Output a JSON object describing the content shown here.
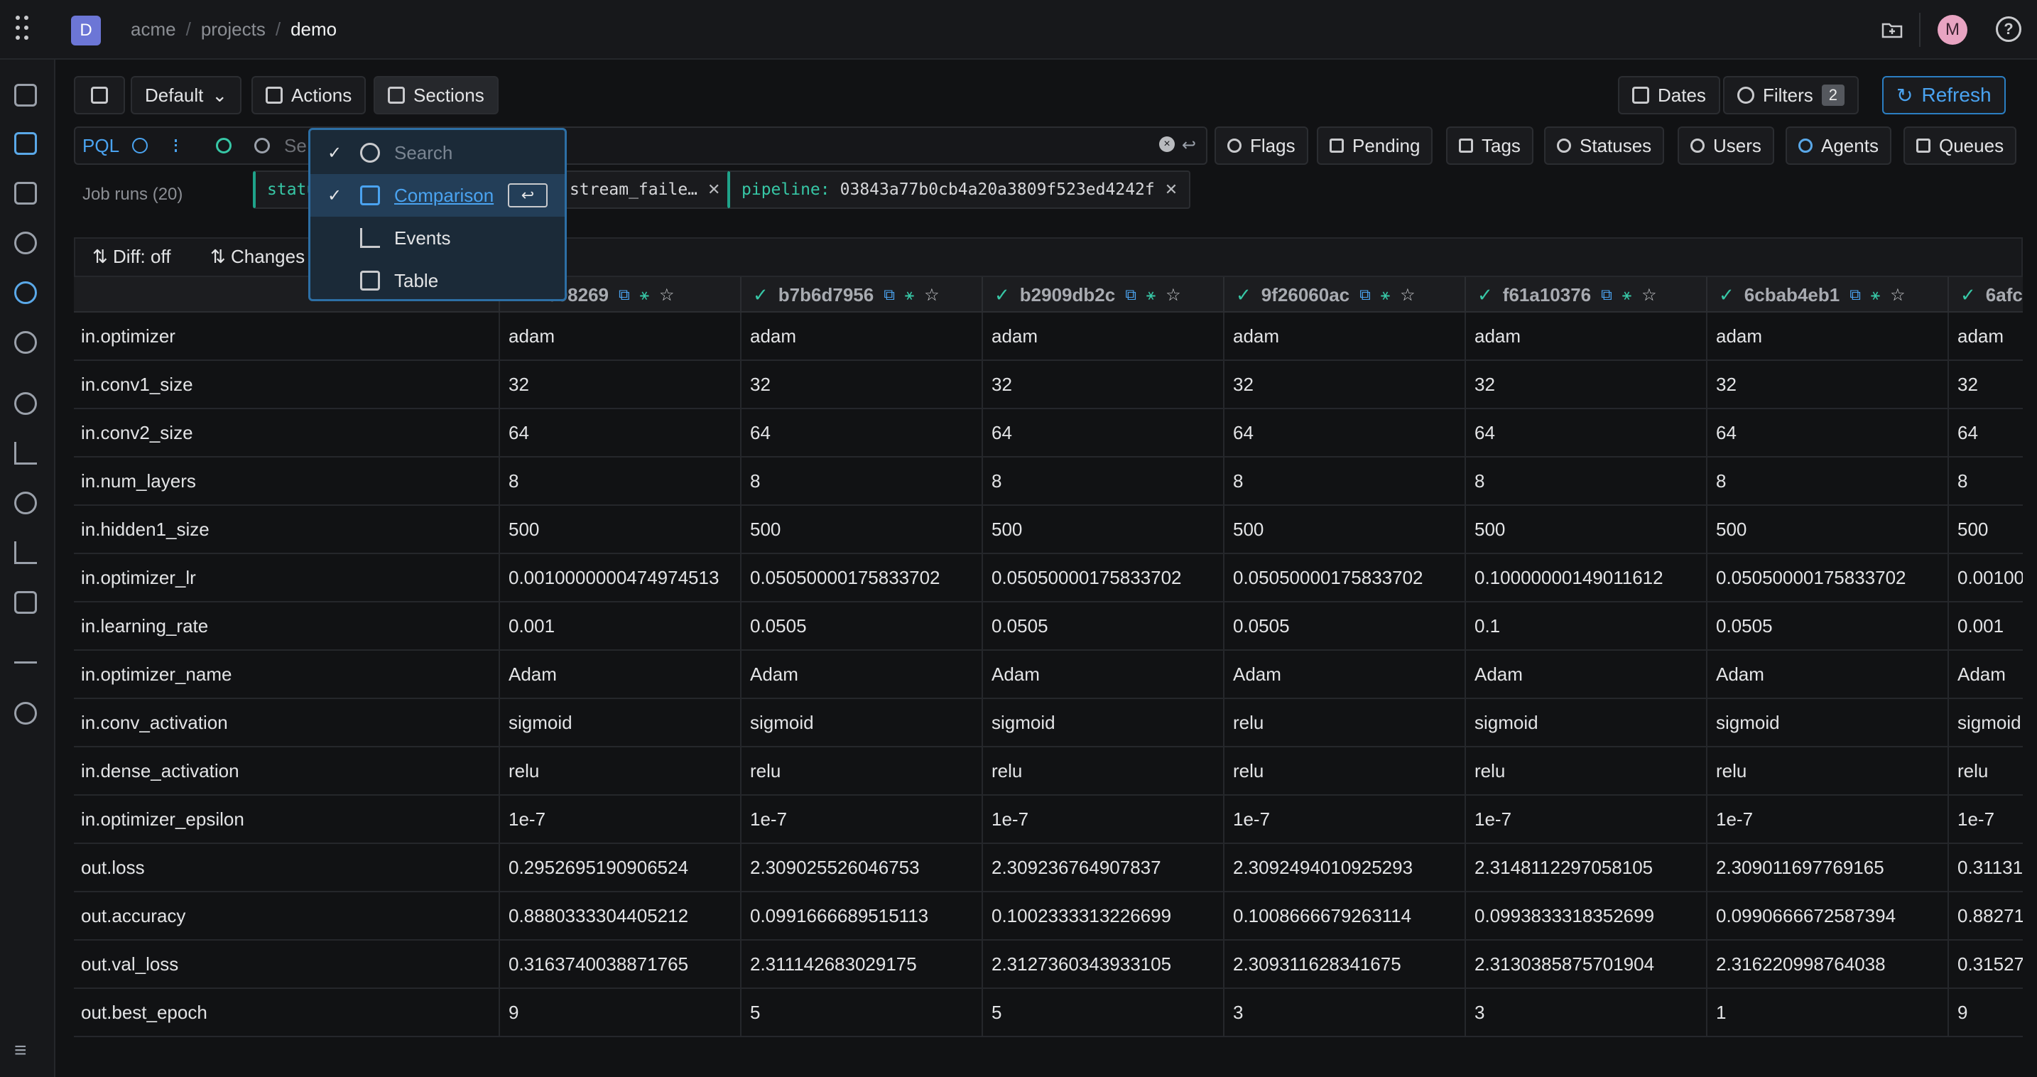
{
  "topbar": {
    "org_initial": "D",
    "breadcrumb": [
      "acme",
      "projects",
      "demo"
    ],
    "user_initial": "M",
    "help": "?"
  },
  "sidebar": {
    "icons": [
      "info-icon",
      "runs-icon",
      "dashboard-icon",
      "dag-icon",
      "agents-icon",
      "connections-icon",
      "search-icon",
      "analytics-icon",
      "history-icon",
      "bar-chart-icon",
      "table-icon",
      "terminal-icon",
      "settings-icon"
    ],
    "collapse": "≡"
  },
  "toolbar": {
    "default_label": "Default",
    "actions_label": "Actions",
    "sections_label": "Sections",
    "dates_label": "Dates",
    "filters_label": "Filters",
    "filters_count": "2",
    "refresh_label": "Refresh"
  },
  "pql": {
    "label": "PQL",
    "placeholder": "Se",
    "chips": [
      "Flags",
      "Pending",
      "Tags",
      "Statuses",
      "Users",
      "Agents",
      "Queues"
    ]
  },
  "filters": {
    "job_runs": "Job runs (20)",
    "tags": [
      {
        "key": "statu",
        "value": ""
      },
      {
        "key": "",
        "value": "stream_faile…"
      },
      {
        "key": "pipeline:",
        "value": "03843a77b0cb4a20a3809f523ed4242f"
      }
    ]
  },
  "table_toolbar": {
    "diff": "Diff: off",
    "changes": "Changes"
  },
  "sections_menu": {
    "search_placeholder": "Search",
    "items": [
      "Comparison",
      "Events",
      "Table"
    ],
    "enter_key": "↩"
  },
  "columns": [
    "2098269",
    "b7b6d7956",
    "b2909db2c",
    "9f26060ac",
    "f61a10376",
    "6cbab4eb1",
    "6afc"
  ],
  "rows": [
    {
      "key": "in.optimizer",
      "values": [
        "adam",
        "adam",
        "adam",
        "adam",
        "adam",
        "adam",
        "adam"
      ]
    },
    {
      "key": "in.conv1_size",
      "values": [
        "32",
        "32",
        "32",
        "32",
        "32",
        "32",
        "32"
      ]
    },
    {
      "key": "in.conv2_size",
      "values": [
        "64",
        "64",
        "64",
        "64",
        "64",
        "64",
        "64"
      ]
    },
    {
      "key": "in.num_layers",
      "values": [
        "8",
        "8",
        "8",
        "8",
        "8",
        "8",
        "8"
      ]
    },
    {
      "key": "in.hidden1_size",
      "values": [
        "500",
        "500",
        "500",
        "500",
        "500",
        "500",
        "500"
      ]
    },
    {
      "key": "in.optimizer_lr",
      "values": [
        "0.0010000000474974513",
        "0.05050000175833702",
        "0.05050000175833702",
        "0.05050000175833702",
        "0.10000000149011612",
        "0.05050000175833702",
        "0.00100"
      ]
    },
    {
      "key": "in.learning_rate",
      "values": [
        "0.001",
        "0.0505",
        "0.0505",
        "0.0505",
        "0.1",
        "0.0505",
        "0.001"
      ]
    },
    {
      "key": "in.optimizer_name",
      "values": [
        "Adam",
        "Adam",
        "Adam",
        "Adam",
        "Adam",
        "Adam",
        "Adam"
      ]
    },
    {
      "key": "in.conv_activation",
      "values": [
        "sigmoid",
        "sigmoid",
        "sigmoid",
        "relu",
        "sigmoid",
        "sigmoid",
        "sigmoid"
      ]
    },
    {
      "key": "in.dense_activation",
      "values": [
        "relu",
        "relu",
        "relu",
        "relu",
        "relu",
        "relu",
        "relu"
      ]
    },
    {
      "key": "in.optimizer_epsilon",
      "values": [
        "1e-7",
        "1e-7",
        "1e-7",
        "1e-7",
        "1e-7",
        "1e-7",
        "1e-7"
      ]
    },
    {
      "key": "out.loss",
      "values": [
        "0.2952695190906524",
        "2.309025526046753",
        "2.309236764907837",
        "2.3092494010925293",
        "2.3148112297058105",
        "2.309011697769165",
        "0.31131"
      ]
    },
    {
      "key": "out.accuracy",
      "values": [
        "0.8880333304405212",
        "0.0991666689515113",
        "0.1002333313226699",
        "0.1008666679263114",
        "0.0993833318352699",
        "0.0990666672587394",
        "0.88271"
      ]
    },
    {
      "key": "out.val_loss",
      "values": [
        "0.3163740038871765",
        "2.311142683029175",
        "2.3127360343933105",
        "2.309311628341675",
        "2.3130385875701904",
        "2.316220998764038",
        "0.31527"
      ]
    },
    {
      "key": "out.best_epoch",
      "values": [
        "9",
        "5",
        "5",
        "3",
        "3",
        "1",
        "9"
      ]
    }
  ]
}
